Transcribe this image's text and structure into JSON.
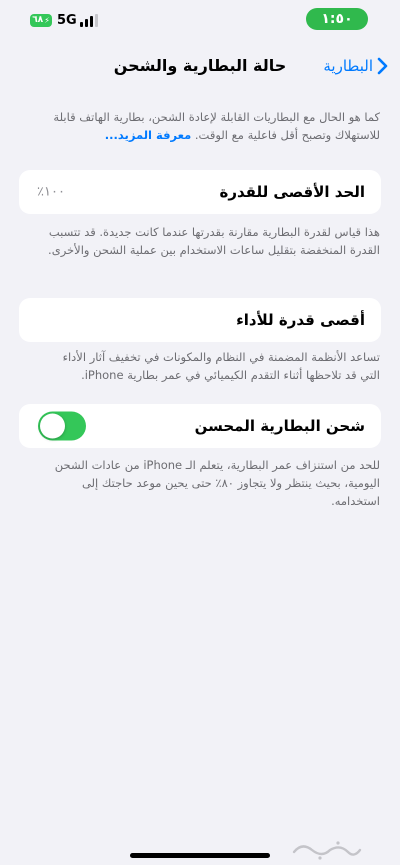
{
  "status_bar": {
    "battery_level": "٦٨",
    "network": "5G",
    "time": "١:٥٠",
    "battery_color": "#34c759",
    "time_pill_color": "#30b94d"
  },
  "nav": {
    "title": "حالة البطارية والشحن",
    "back_label": "البطارية",
    "accent_color": "#007aff"
  },
  "intro": {
    "text": "كما هو الحال مع البطاريات القابلة لإعادة الشحن، بطارية الهاتف قابلة للاستهلاك وتصبح أقل فاعلية مع الوقت.",
    "link": "معرفة المزيد..."
  },
  "max_capacity": {
    "label": "الحد الأقصى للقدرة",
    "value": "٪١٠٠",
    "footer": "هذا قياس لقدرة البطارية مقارنة بقدرتها عندما كانت جديدة. قد تتسبب القدرة المنخفضة بتقليل ساعات الاستخدام بين عملية الشحن والأخرى."
  },
  "peak_performance": {
    "label": "أقصى قدرة للأداء",
    "footer": "تساعد الأنظمة المضمنة في النظام والمكونات في تخفيف آثار الأداء التي قد تلاحظها أثناء التقدم الكيميائي في عمر بطارية iPhone."
  },
  "optimized_charging": {
    "label": "شحن البطارية المحسن",
    "enabled": true,
    "toggle_color": "#34c759",
    "footer": "للحد من استنزاف عمر البطارية، يتعلم الـ iPhone من عادات الشحن اليومية، بحيث ينتظر ولا يتجاوز ٨٠٪ حتى يحين موعد حاجتك إلى استخدامه."
  },
  "icons": {
    "back": "chevron-right-icon",
    "signal": "cellular-signal-icon",
    "battery": "battery-charging-icon",
    "watermark": "watermark-logo-icon"
  }
}
